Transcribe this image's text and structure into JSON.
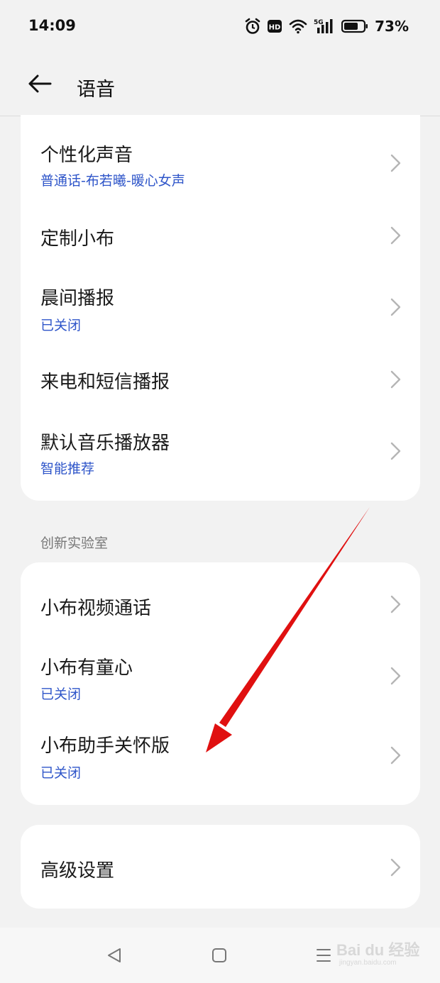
{
  "status_bar": {
    "time": "14:09",
    "battery_percent": "73%",
    "battery_level": 0.73,
    "icons": [
      "alarm-icon",
      "hd-icon",
      "wifi-icon",
      "5g-signal-icon",
      "battery-icon"
    ],
    "network_label": "5G",
    "hd_label": "HD"
  },
  "header": {
    "title": "语音",
    "back_icon": "arrow-left-icon"
  },
  "group1": {
    "items": [
      {
        "title": "个性化声音",
        "subtitle": "普通话-布若曦-暖心女声"
      },
      {
        "title": "定制小布"
      },
      {
        "title": "晨间播报",
        "subtitle": "已关闭"
      },
      {
        "title": "来电和短信播报"
      },
      {
        "title": "默认音乐播放器",
        "subtitle": "智能推荐"
      }
    ]
  },
  "group2": {
    "label": "创新实验室",
    "items": [
      {
        "title": "小布视频通话"
      },
      {
        "title": "小布有童心",
        "subtitle": "已关闭"
      },
      {
        "title": "小布助手关怀版",
        "subtitle": "已关闭"
      }
    ]
  },
  "group3": {
    "items": [
      {
        "title": "高级设置"
      }
    ]
  },
  "nav_bar": {
    "icons": [
      "triangle-back-icon",
      "square-home-icon",
      "menu-recents-icon"
    ]
  },
  "watermark": {
    "logo": "Bai du 经验",
    "url": "jingyan.baidu.com"
  },
  "colors": {
    "background": "#f2f2f2",
    "card": "#ffffff",
    "subtitle_blue": "#2e55c9",
    "annotation_arrow": "#e01010"
  }
}
